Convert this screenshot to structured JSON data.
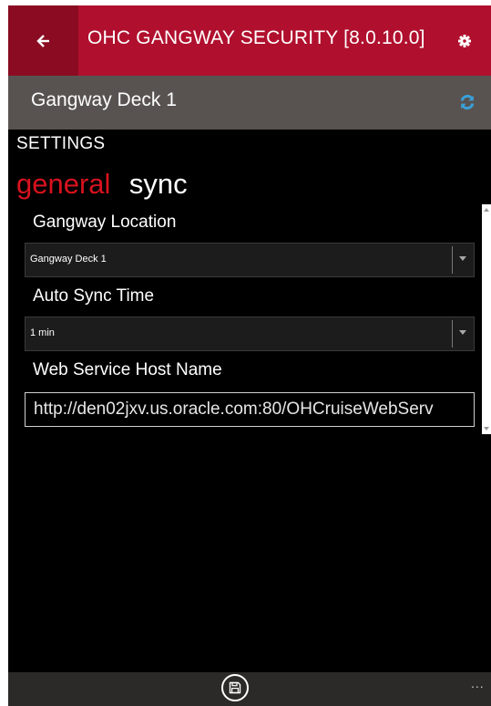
{
  "titlebar": {
    "title": "OHC GANGWAY SECURITY [8.0.10.0]",
    "back_icon": "back-arrow-icon",
    "settings_icon": "gear-icon"
  },
  "subheader": {
    "title": "Gangway Deck 1",
    "refresh_icon": "sync-icon",
    "refresh_icon_color": "#3aa0d8"
  },
  "settings": {
    "heading": "SETTINGS",
    "tabs": [
      {
        "label": "general",
        "active": true
      },
      {
        "label": "sync",
        "active": false
      }
    ],
    "fields": {
      "gangway_location": {
        "label": "Gangway Location",
        "value": "Gangway Deck 1"
      },
      "auto_sync_time": {
        "label": "Auto Sync Time",
        "value": "1 min"
      },
      "web_service_host": {
        "label": "Web Service Host Name",
        "value": "http://den02jxv.us.oracle.com:80/OHCruiseWebServ"
      }
    }
  },
  "appbar": {
    "save_icon": "save-icon",
    "more_label": "..."
  },
  "colors": {
    "titlebar": "#b0102e",
    "back_button": "#8a0b22",
    "subheader": "#585351",
    "accent_red": "#d8121e",
    "background": "#000000",
    "appbar": "#2c2a29"
  }
}
